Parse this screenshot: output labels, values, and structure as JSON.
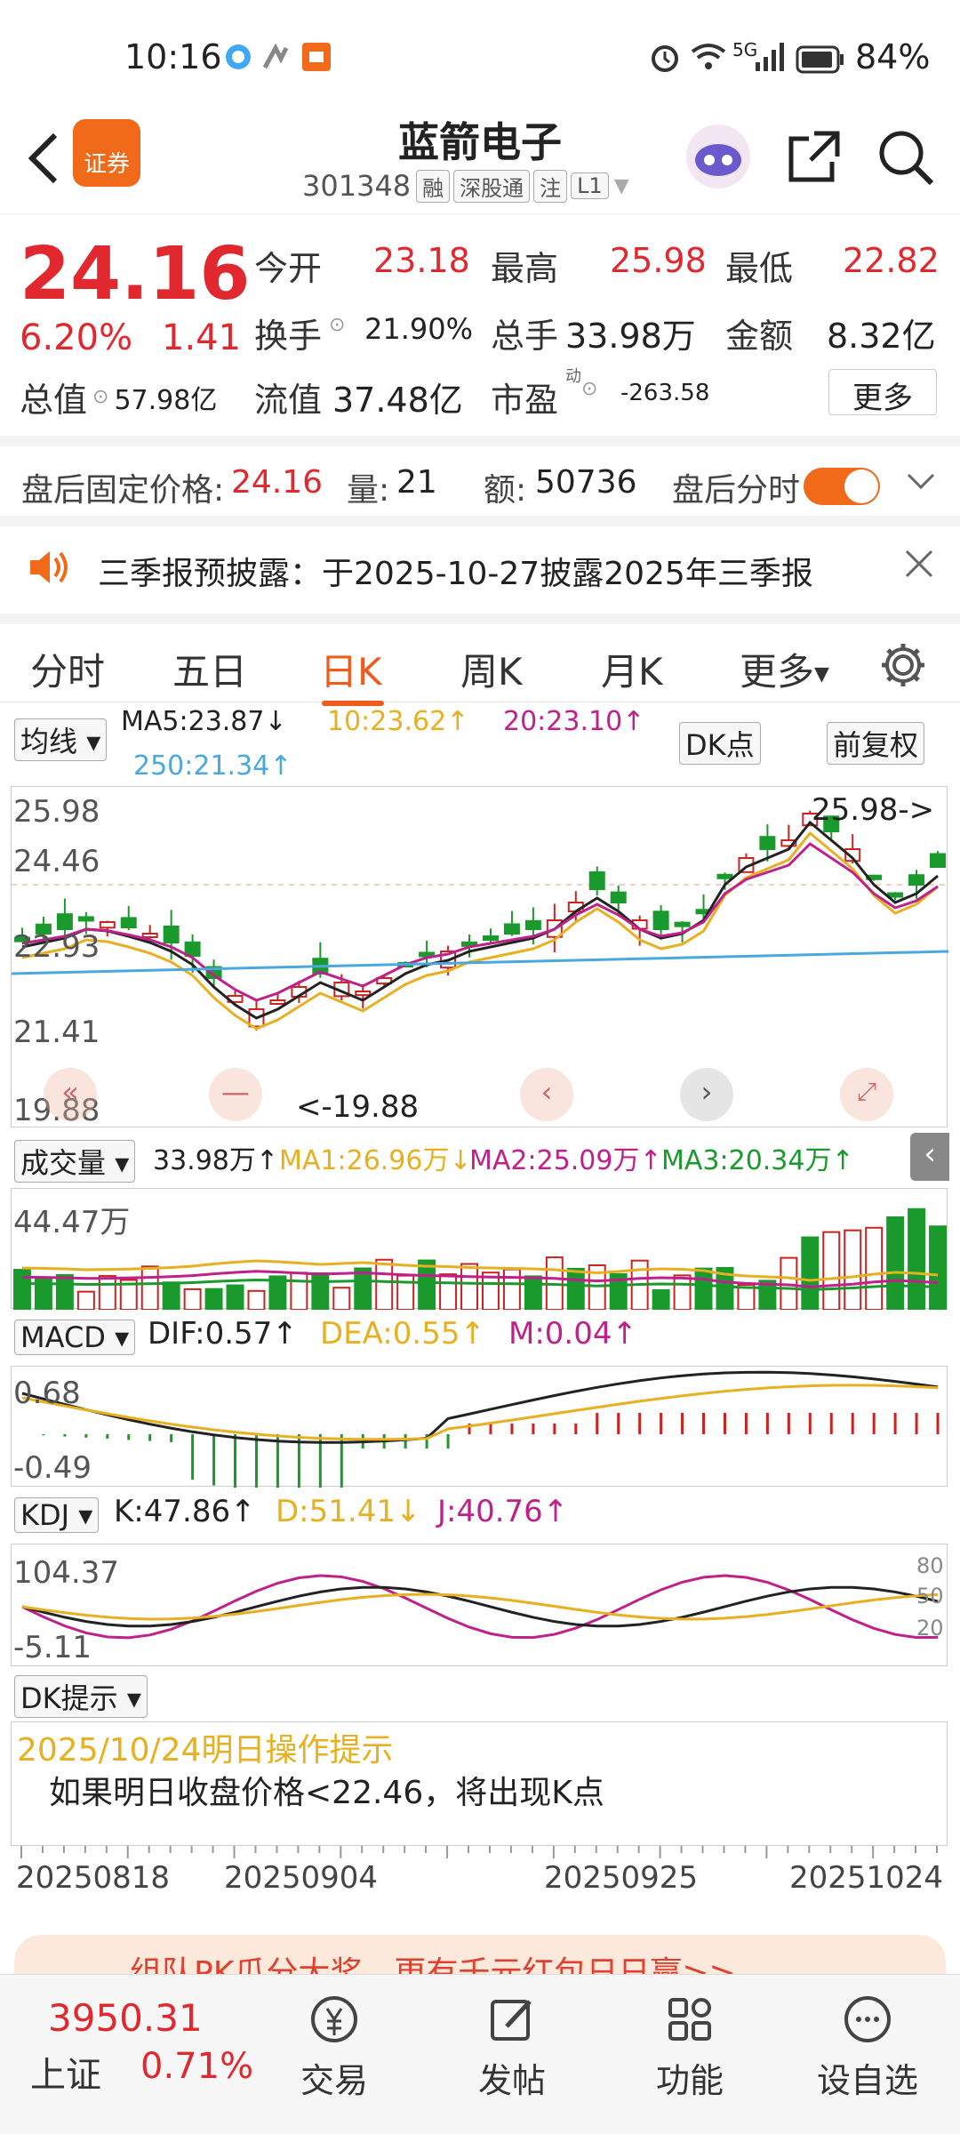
{
  "status": {
    "time": "10:16",
    "battery": "84%",
    "network": "5G"
  },
  "header": {
    "name": "蓝箭电子",
    "code": "301348",
    "tags": [
      "融",
      "深股通",
      "注",
      "L1"
    ],
    "logo": "证券"
  },
  "quote": {
    "price": "24.16",
    "pct": "6.20%",
    "chg": "1.41",
    "open_label": "今开",
    "open": "23.18",
    "high_label": "最高",
    "high": "25.98",
    "low_label": "最低",
    "low": "22.82",
    "turnover_label": "换手",
    "turnover": "21.90%",
    "vol_label": "总手",
    "vol": "33.98万",
    "amt_label": "金额",
    "amt": "8.32亿",
    "mcap_label": "总值",
    "mcap": "57.98亿",
    "float_label": "流值",
    "float": "37.48亿",
    "pe_label": "市盈",
    "pe_sup": "动",
    "pe": "-263.58",
    "more": "更多"
  },
  "afterhours": {
    "fixed_label": "盘后固定价格:",
    "fixed": "24.16",
    "vol_label": "量:",
    "vol": "21",
    "amt_label": "额:",
    "amt": "50736",
    "split_label": "盘后分时"
  },
  "notice": {
    "text": "三季报预披露：于2025-10-27披露2025年三季报"
  },
  "tabs": [
    "分时",
    "五日",
    "日K",
    "周K",
    "月K",
    "更多",
    "settings"
  ],
  "kline": {
    "ma_label": "均线",
    "ma5": "MA5:23.87↓",
    "ma10": "10:23.62↑",
    "ma20": "20:23.10↑",
    "ma250": "250:21.34↑",
    "dk": "DK点",
    "fq": "前复权",
    "y": [
      "25.98",
      "24.46",
      "22.93",
      "21.41",
      "19.88"
    ],
    "hi": "25.98->",
    "lo": "<-19.88"
  },
  "volume": {
    "label": "成交量",
    "v": "33.98万↑",
    "ma1": "MA1:26.96万↓",
    "ma2": "MA2:25.09万↑",
    "ma3": "MA3:20.34万↑",
    "y": "44.47万"
  },
  "macd": {
    "label": "MACD",
    "dif": "DIF:0.57↑",
    "dea": "DEA:0.55↑",
    "m": "M:0.04↑",
    "y1": "0.68",
    "y2": "-0.49"
  },
  "kdj": {
    "label": "KDJ",
    "k": "K:47.86↑",
    "d": "D:51.41↓",
    "j": "J:40.76↑",
    "y1": "104.37",
    "y2": "-5.11",
    "r80": "80",
    "r50": "50",
    "r20": "20"
  },
  "dk": {
    "label": "DK提示",
    "date": "2025/10/24明日操作提示",
    "text": "如果明日收盘价格<22.46，将出现K点"
  },
  "dates": [
    "20250818",
    "20250904",
    "20250925",
    "20251024"
  ],
  "promo": {
    "text": "组队PK瓜分大奖，更有千元红包日日赢>>"
  },
  "bottom": {
    "index": "3950.31",
    "index_name": "上证",
    "index_pct": "0.71%",
    "trade": "交易",
    "post": "发帖",
    "func": "功能",
    "watch": "设自选"
  }
}
